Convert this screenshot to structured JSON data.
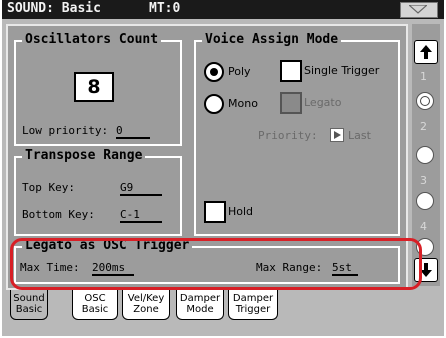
{
  "title": {
    "section": "SOUND: Basic",
    "mt": "MT:0"
  },
  "oscillators": {
    "title": "Oscillators Count",
    "count": "8",
    "low_priority_label": "Low priority:",
    "low_priority_value": "0"
  },
  "transpose": {
    "title": "Transpose Range",
    "top_key_label": "Top Key:",
    "top_key_value": "G9",
    "bottom_key_label": "Bottom Key:",
    "bottom_key_value": "C-1"
  },
  "voice_assign": {
    "title": "Voice Assign Mode",
    "poly_label": "Poly",
    "poly_selected": true,
    "single_trigger_label": "Single Trigger",
    "single_trigger_checked": false,
    "mono_label": "Mono",
    "mono_selected": false,
    "legato_label": "Legato",
    "legato_enabled": false,
    "priority_label": "Priority:",
    "priority_value": "Last",
    "hold_label": "Hold",
    "hold_checked": false
  },
  "legato_trigger": {
    "title": "Legato as OSC Trigger",
    "max_time_label": "Max Time:",
    "max_time_value": "200ms",
    "max_range_label": "Max Range:",
    "max_range_value": "5st"
  },
  "scroll": {
    "numbers": [
      "1",
      "2",
      "3",
      "4"
    ],
    "selected_index": 0
  },
  "tabs": [
    {
      "line1": "Sound",
      "line2": "Basic",
      "selected": true
    },
    {
      "line1": "OSC",
      "line2": "Basic",
      "selected": false
    },
    {
      "line1": "Vel/Key",
      "line2": "Zone",
      "selected": false
    },
    {
      "line1": "Damper",
      "line2": "Mode",
      "selected": false
    },
    {
      "line1": "Damper",
      "line2": "Trigger",
      "selected": false
    }
  ],
  "colors": {
    "background": "#b9b9b9",
    "panel": "#9c9c9c",
    "highlight": "#d81f26",
    "titlebar": "#1a1a1a"
  }
}
